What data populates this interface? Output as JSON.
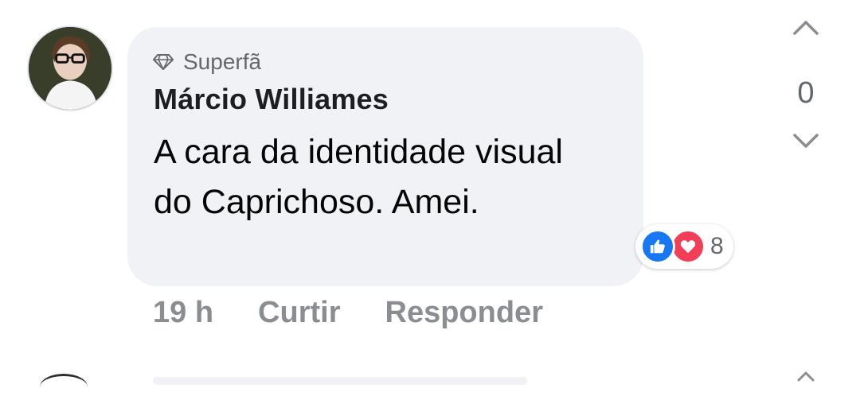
{
  "comment": {
    "badge_label": "Superfã",
    "author": "Márcio Williames",
    "text": "A cara da identidade visual do Caprichoso. Amei.",
    "time": "19 h",
    "like_label": "Curtir",
    "reply_label": "Responder",
    "reaction_count": "8",
    "reaction_types": [
      "like-icon",
      "love-icon"
    ]
  },
  "vote": {
    "count": "0",
    "up_icon": "chevron-up-icon",
    "down_icon": "chevron-down-icon"
  },
  "colors": {
    "bubble_bg": "#f0f2f5",
    "like_blue": "#1877f2",
    "love_red": "#f33e58",
    "muted_text": "#65676b"
  }
}
